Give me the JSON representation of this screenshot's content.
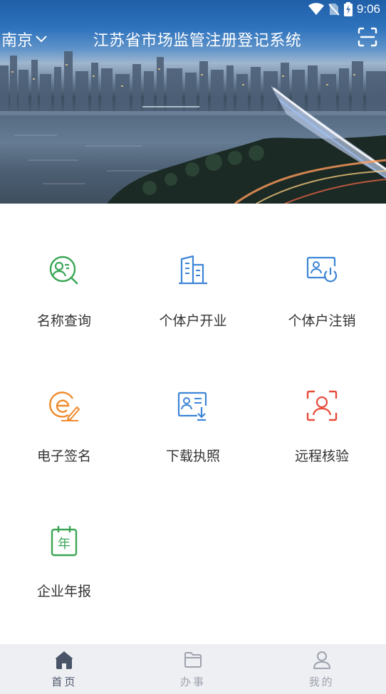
{
  "status": {
    "time": "9:06"
  },
  "header": {
    "city": "南京",
    "title": "江苏省市场监管注册登记系统"
  },
  "grid": [
    {
      "label": "名称查询",
      "icon": "name-search-icon",
      "color": "#3aa655"
    },
    {
      "label": "个体户开业",
      "icon": "building-icon",
      "color": "#3d86d6"
    },
    {
      "label": "个体户注销",
      "icon": "id-card-power-icon",
      "color": "#3d86d6"
    },
    {
      "label": "电子签名",
      "icon": "e-signature-icon",
      "color": "#ef8a2b"
    },
    {
      "label": "下载执照",
      "icon": "license-download-icon",
      "color": "#3d86d6"
    },
    {
      "label": "远程核验",
      "icon": "face-scan-icon",
      "color": "#e84b3a"
    },
    {
      "label": "企业年报",
      "icon": "calendar-year-icon",
      "color": "#3aa655"
    }
  ],
  "year_glyph": "年",
  "tabs": [
    {
      "label": "首页",
      "icon": "home-icon",
      "active": true
    },
    {
      "label": "办事",
      "icon": "folder-icon",
      "active": false
    },
    {
      "label": "我的",
      "icon": "user-icon",
      "active": false
    }
  ]
}
